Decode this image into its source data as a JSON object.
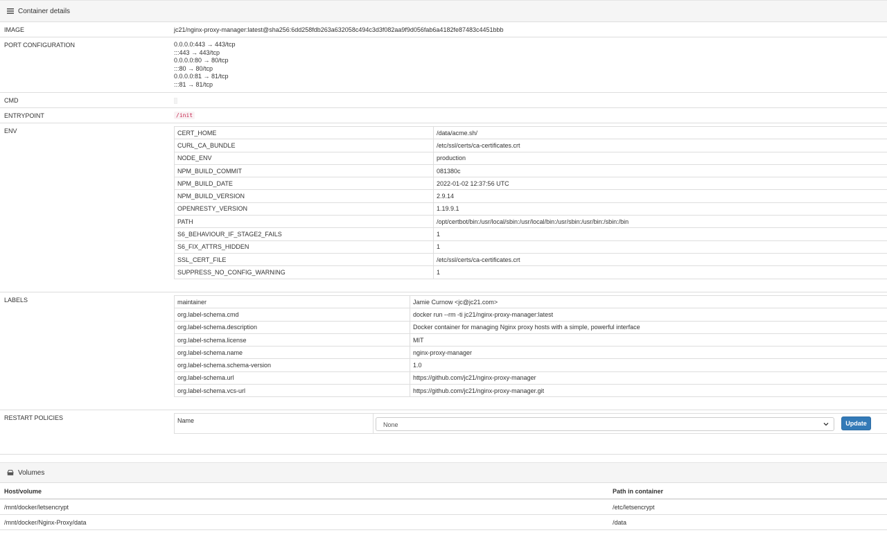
{
  "details_panel": {
    "title": "Container details"
  },
  "image": {
    "label": "IMAGE",
    "value": "jc21/nginx-proxy-manager:latest@sha256:6dd258fdb263a632058c494c3d3f082aa9f9d056fab6a4182fe87483c4451bbb"
  },
  "ports": {
    "label": "PORT CONFIGURATION",
    "items": [
      "0.0.0.0:443 → 443/tcp",
      ":::443 → 443/tcp",
      "0.0.0.0:80 → 80/tcp",
      ":::80 → 80/tcp",
      "0.0.0.0:81 → 81/tcp",
      ":::81 → 81/tcp"
    ]
  },
  "cmd": {
    "label": "CMD"
  },
  "entrypoint": {
    "label": "ENTRYPOINT",
    "value": "/init"
  },
  "env": {
    "label": "ENV",
    "rows": [
      [
        "CERT_HOME",
        "/data/acme.sh/"
      ],
      [
        "CURL_CA_BUNDLE",
        "/etc/ssl/certs/ca-certificates.crt"
      ],
      [
        "NODE_ENV",
        "production"
      ],
      [
        "NPM_BUILD_COMMIT",
        "081380c"
      ],
      [
        "NPM_BUILD_DATE",
        "2022-01-02 12:37:56 UTC"
      ],
      [
        "NPM_BUILD_VERSION",
        "2.9.14"
      ],
      [
        "OPENRESTY_VERSION",
        "1.19.9.1"
      ],
      [
        "PATH",
        "/opt/certbot/bin:/usr/local/sbin:/usr/local/bin:/usr/sbin:/usr/bin:/sbin:/bin"
      ],
      [
        "S6_BEHAVIOUR_IF_STAGE2_FAILS",
        "1"
      ],
      [
        "S6_FIX_ATTRS_HIDDEN",
        "1"
      ],
      [
        "SSL_CERT_FILE",
        "/etc/ssl/certs/ca-certificates.crt"
      ],
      [
        "SUPPRESS_NO_CONFIG_WARNING",
        "1"
      ]
    ]
  },
  "labels": {
    "label": "LABELS",
    "rows": [
      [
        "maintainer",
        "Jamie Curnow <jc@jc21.com>"
      ],
      [
        "org.label-schema.cmd",
        "docker run --rm -ti jc21/nginx-proxy-manager:latest"
      ],
      [
        "org.label-schema.description",
        "Docker container for managing Nginx proxy hosts with a simple, powerful interface"
      ],
      [
        "org.label-schema.license",
        "MIT"
      ],
      [
        "org.label-schema.name",
        "nginx-proxy-manager"
      ],
      [
        "org.label-schema.schema-version",
        "1.0"
      ],
      [
        "org.label-schema.url",
        "https://github.com/jc21/nginx-proxy-manager"
      ],
      [
        "org.label-schema.vcs-url",
        "https://github.com/jc21/nginx-proxy-manager.git"
      ]
    ]
  },
  "restart": {
    "label": "RESTART POLICIES",
    "name_label": "Name",
    "selected": "None",
    "update_label": "Update"
  },
  "volumes_panel": {
    "title": "Volumes",
    "col_host": "Host/volume",
    "col_path": "Path in container",
    "rows": [
      [
        "/mnt/docker/letsencrypt",
        "/etc/letsencrypt"
      ],
      [
        "/mnt/docker/Nginx-Proxy/data",
        "/data"
      ]
    ]
  }
}
